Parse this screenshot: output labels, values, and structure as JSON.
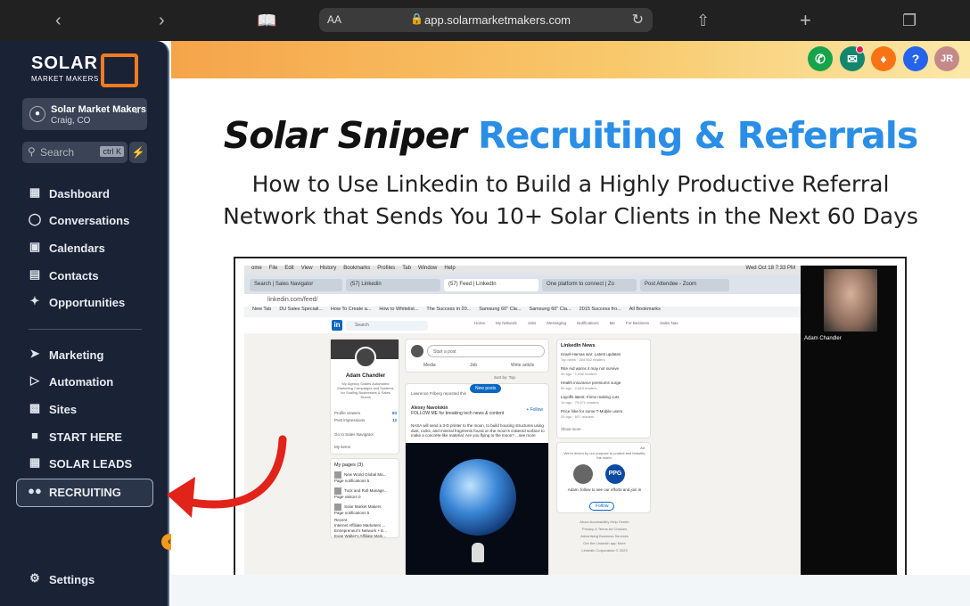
{
  "browser": {
    "text_size": "AA",
    "url": "app.solarmarketmakers.com"
  },
  "sidebar": {
    "logo_word": "SOLAR",
    "logo_sub": "MARKET MAKERS",
    "account": {
      "name": "Solar Market Makers",
      "location": "Craig, CO"
    },
    "search": {
      "placeholder": "Search",
      "shortcut": "ctrl K"
    },
    "items": [
      {
        "label": "Dashboard",
        "icon": "grid-icon"
      },
      {
        "label": "Conversations",
        "icon": "chat-icon"
      },
      {
        "label": "Calendars",
        "icon": "calendar-icon"
      },
      {
        "label": "Contacts",
        "icon": "contacts-icon"
      },
      {
        "label": "Opportunities",
        "icon": "opportunities-icon"
      },
      {
        "label": "Marketing",
        "icon": "send-icon"
      },
      {
        "label": "Automation",
        "icon": "play-icon"
      },
      {
        "label": "Sites",
        "icon": "sites-icon"
      },
      {
        "label": "START HERE",
        "icon": "video-icon"
      },
      {
        "label": "SOLAR LEADS",
        "icon": "leads-icon"
      },
      {
        "label": "RECRUITING",
        "icon": "users-icon"
      }
    ],
    "settings_label": "Settings"
  },
  "header": {
    "avatar_initials": "JR",
    "help_label": "?"
  },
  "content": {
    "title_part1": "Solar Sniper",
    "title_part2": "Recruiting & Referrals",
    "subtitle": "How to Use Linkedin to Build a Highly Productive Referral Network that Sends You 10+ Solar Clients in the Next 60 Days"
  },
  "embedded_video": {
    "menu_items": [
      "ome",
      "File",
      "Edit",
      "View",
      "History",
      "Bookmarks",
      "Profiles",
      "Tab",
      "Window",
      "Help"
    ],
    "clock": "Wed Oct 18  7:33 PM",
    "tabs": [
      "Search | Sales Navigator",
      "(57) Linkedin",
      "(57) Feed | LinkedIn",
      "One platform to connect | Zo",
      "Post Attendee - Zoom"
    ],
    "address": "linkedin.com/feed/",
    "bookmarks": [
      "New Tab",
      "DU Sales Speciali...",
      "How To Create a...",
      "How to Whitelist...",
      "The Success in 20...",
      "Samsung 60\" Cla...",
      "Samsung 60\" Cla...",
      "2015 Success fro...",
      "All Bookmarks"
    ],
    "li_search": "Search",
    "li_nav": [
      "Home",
      "My Network",
      "Jobs",
      "Messaging",
      "Notifications",
      "Me",
      "For Business",
      "Sales Nav"
    ],
    "profile": {
      "name": "Adam Chandler",
      "desc": "My Agency Scales Automated Marketing Campaigns and Systems for Scaling Businesses & Sales Teams",
      "stats": [
        {
          "label": "Profile viewers",
          "value": "83"
        },
        {
          "label": "Post impressions",
          "value": "12"
        }
      ],
      "links": [
        "Go to Sales Navigator",
        "My items"
      ]
    },
    "pages": {
      "heading": "My pages (3)",
      "items": [
        {
          "name": "New World Global Ma...",
          "meta": "Page notifications",
          "count": "5"
        },
        {
          "name": "Tuck and Roll Manage...",
          "meta": "Page visitors",
          "count": "0"
        },
        {
          "name": "Solar Market Makers",
          "meta": "Page notifications",
          "count": "5"
        }
      ],
      "recent_heading": "Recent",
      "recent": [
        "Internet Affiliate Marketers ...",
        "Entrepreneur's Network + E...",
        "Evan Walter's Affiliate Mark..."
      ]
    },
    "post": {
      "placeholder": "Start a post",
      "actions": [
        "Media",
        "Job",
        "Write article"
      ],
      "sort": "Sort by: Top"
    },
    "feed": {
      "new_posts": "New posts",
      "liker": "Lawrence Friberg reposted this",
      "author": "Alexey Navolokin",
      "author_meta": "FOLLOW ME for breaking tech news & content",
      "follow": "+ Follow",
      "text": "NASA will send a 3-D printer to the moon, to build housing structures using dust, rocks, and mineral fragments found on the moon's cratered surface to make a concrete-like material. Are you flying to the moon?",
      "more": "...see more"
    },
    "news": {
      "heading": "LinkedIn News",
      "items": [
        {
          "title": "Israel-Hamas war: Latest updates",
          "meta": "Top news · 264,952 readers"
        },
        {
          "title": "Rite Aid warns it may not survive",
          "meta": "4h ago · 1,836 readers"
        },
        {
          "title": "Health insurance premiums surge",
          "meta": "6h ago · 2,643 readers"
        },
        {
          "title": "Layoffs latest: Firms making cuts",
          "meta": "1d ago · 79,671 readers"
        },
        {
          "title": "Price hike for some T-Mobile users",
          "meta": "2h ago · 607 readers"
        }
      ],
      "show_more": "Show more"
    },
    "ad": {
      "label": "Ad",
      "top": "We're driven by our purpose to protect and beautify the world.",
      "brand": "PPG",
      "text": "Adam, follow to see our efforts and join in",
      "button": "Follow"
    },
    "footer": [
      "About",
      "Accessibility",
      "Help Center",
      "Privacy & Terms",
      "Ad Choices",
      "Advertising",
      "Business Services",
      "Get the LinkedIn app",
      "More",
      "LinkedIn Corporation © 2023"
    ],
    "participant": "Adam Chandler"
  },
  "colors": {
    "sidebar_bg": "#1a2236",
    "accent_orange": "#f07b22",
    "title_blue": "#2a8ee6",
    "arrow_red": "#e2231a"
  }
}
